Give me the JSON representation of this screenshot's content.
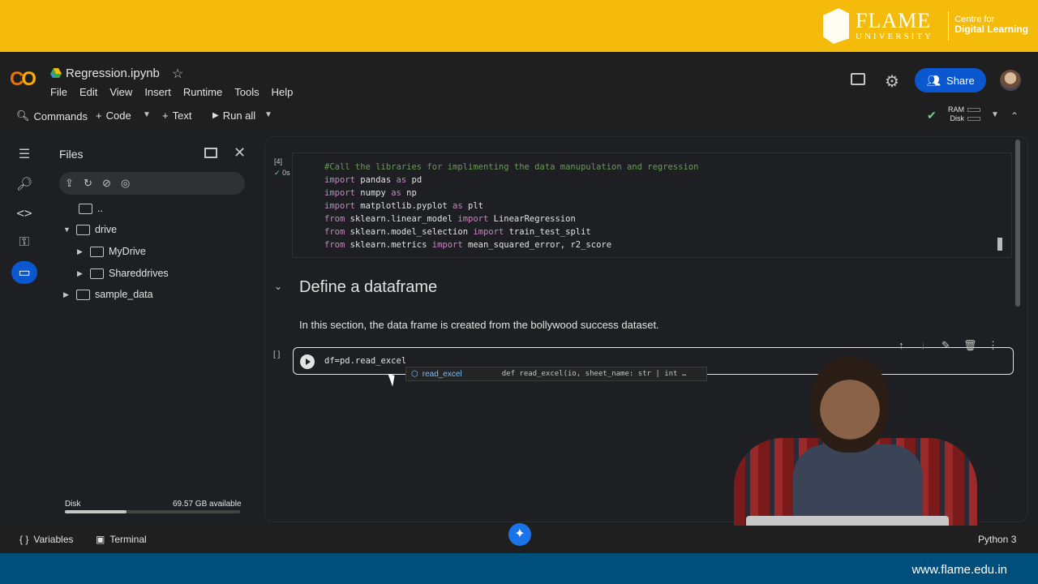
{
  "brand": {
    "name": "FLAME",
    "sub": "UNIVERSITY",
    "centre_line1": "Centre for",
    "centre_line2": "Digital Learning",
    "footer_url": "www.flame.edu.in",
    "color": "#f5bb0a"
  },
  "header": {
    "logo": "CO",
    "notebook_title": "Regression.ipynb",
    "menu": [
      "File",
      "Edit",
      "View",
      "Insert",
      "Runtime",
      "Tools",
      "Help"
    ],
    "share_label": "Share"
  },
  "toolbar": {
    "commands": "Commands",
    "code": "Code",
    "text": "Text",
    "run_all": "Run all",
    "ram": "RAM",
    "disk": "Disk"
  },
  "files": {
    "title": "Files",
    "tree": [
      {
        "label": "..",
        "expandable": false
      },
      {
        "label": "drive",
        "expandable": true,
        "expanded": true
      },
      {
        "label": "MyDrive",
        "expandable": true
      },
      {
        "label": "Shareddrives",
        "expandable": true
      },
      {
        "label": "sample_data",
        "expandable": true
      }
    ],
    "disk_label": "Disk",
    "disk_available": "69.57 GB available",
    "disk_used_fraction": 0.35
  },
  "cells": {
    "cell1": {
      "exec_count": "[4]",
      "exec_time": "0s",
      "lines": [
        "#Call the libraries for implimenting the data manupulation and regression",
        "import pandas as pd",
        "import numpy as np",
        "import matplotlib.pyplot as plt",
        "from sklearn.linear_model import LinearRegression",
        "from sklearn.model_selection import train_test_split",
        "from sklearn.metrics import mean_squared_error, r2_score"
      ]
    },
    "section_title": "Define a dataframe",
    "section_text": "In this section, the data frame is created from the bollywood success dataset.",
    "cell2": {
      "exec_count": "[ ]",
      "code": "df=pd.read_excel",
      "autocomplete_name": "read_excel",
      "autocomplete_sig": "def read_excel(io, sheet_name: str | int …"
    }
  },
  "statusbar": {
    "variables": "Variables",
    "terminal": "Terminal",
    "runtime": "Python 3"
  }
}
